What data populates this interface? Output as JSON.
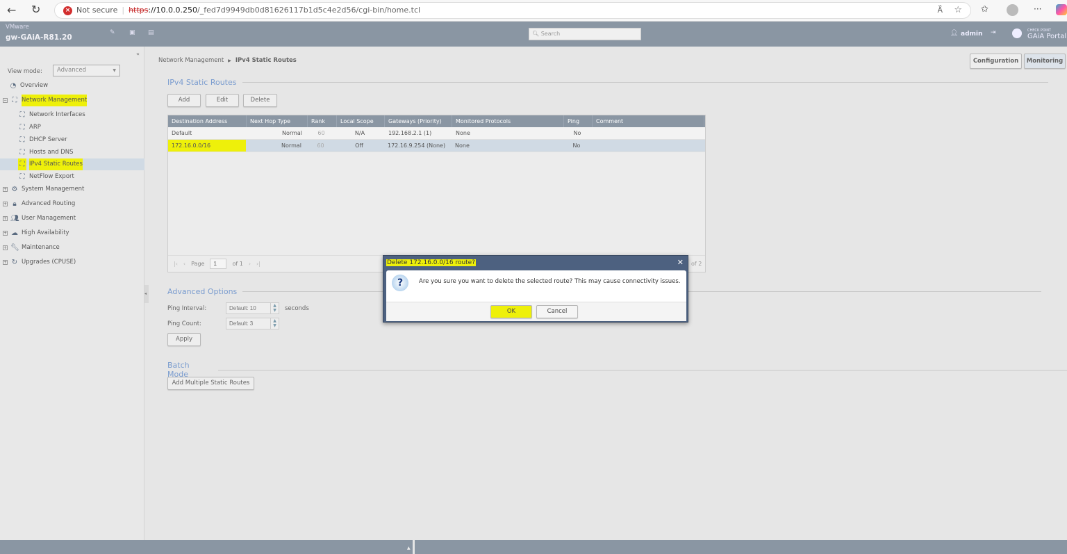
{
  "browser": {
    "security": "Not secure",
    "url_scheme": "https",
    "url_host": "://10.0.0.250",
    "url_path": "/_fed7d9949db0d81626117b1d5c4e2d56/cgi-bin/home.tcl"
  },
  "header": {
    "vendor": "VMware",
    "hostname": "gw-GAiA-R81.20",
    "search_placeholder": "Search",
    "user": "admin",
    "brand_small": "CHECK POINT",
    "brand": "GAiA Portal"
  },
  "top_tabs": {
    "configuration": "Configuration",
    "monitoring": "Monitoring"
  },
  "sidebar": {
    "view_mode_label": "View mode:",
    "view_mode_value": "Advanced",
    "items": [
      {
        "label": "Overview",
        "icon": "overview-icon"
      },
      {
        "label": "Network Management",
        "icon": "network-icon"
      },
      {
        "label": "Network Interfaces",
        "icon": "network-icon"
      },
      {
        "label": "ARP",
        "icon": "network-icon"
      },
      {
        "label": "DHCP Server",
        "icon": "network-icon"
      },
      {
        "label": "Hosts and DNS",
        "icon": "network-icon"
      },
      {
        "label": "IPv4 Static Routes",
        "icon": "network-icon"
      },
      {
        "label": "NetFlow Export",
        "icon": "network-icon"
      },
      {
        "label": "System Management",
        "icon": "gear-icon"
      },
      {
        "label": "Advanced Routing",
        "icon": "routing-icon"
      },
      {
        "label": "User Management",
        "icon": "users-icon"
      },
      {
        "label": "High Availability",
        "icon": "cloud-icon"
      },
      {
        "label": "Maintenance",
        "icon": "wrench-icon"
      },
      {
        "label": "Upgrades (CPUSE)",
        "icon": "refresh-icon"
      }
    ]
  },
  "breadcrumb": {
    "parent": "Network Management",
    "current": "IPv4 Static Routes"
  },
  "main": {
    "title": "IPv4 Static Routes",
    "add": "Add",
    "edit": "Edit",
    "delete": "Delete",
    "columns": [
      "Destination Address",
      "Next Hop Type",
      "Rank",
      "Local Scope",
      "Gateways (Priority)",
      "Monitored Protocols",
      "Ping",
      "Comment"
    ],
    "rows": [
      [
        "Default",
        "Normal",
        "60",
        "N/A",
        "192.168.2.1 (1)",
        "None",
        "No",
        ""
      ],
      [
        "172.16.0.0/16",
        "Normal",
        "60",
        "Off",
        "172.16.9.254 (None)",
        "None",
        "No",
        ""
      ]
    ],
    "pager": {
      "page_label": "Page",
      "page": "1",
      "of": "of 1",
      "extra": "of 2"
    },
    "advanced": {
      "title": "Advanced Options",
      "ping_interval_label": "Ping Interval:",
      "ping_interval_placeholder": "Default: 10",
      "seconds": "seconds",
      "ping_count_label": "Ping Count:",
      "ping_count_placeholder": "Default: 3",
      "apply": "Apply"
    },
    "batch": {
      "title": "Batch Mode",
      "add_multiple": "Add Multiple Static Routes"
    }
  },
  "dialog": {
    "title": "Delete 172.16.0.0/16 route?",
    "message": "Are you sure you want to delete the selected route? This may cause connectivity issues.",
    "ok": "OK",
    "cancel": "Cancel"
  }
}
